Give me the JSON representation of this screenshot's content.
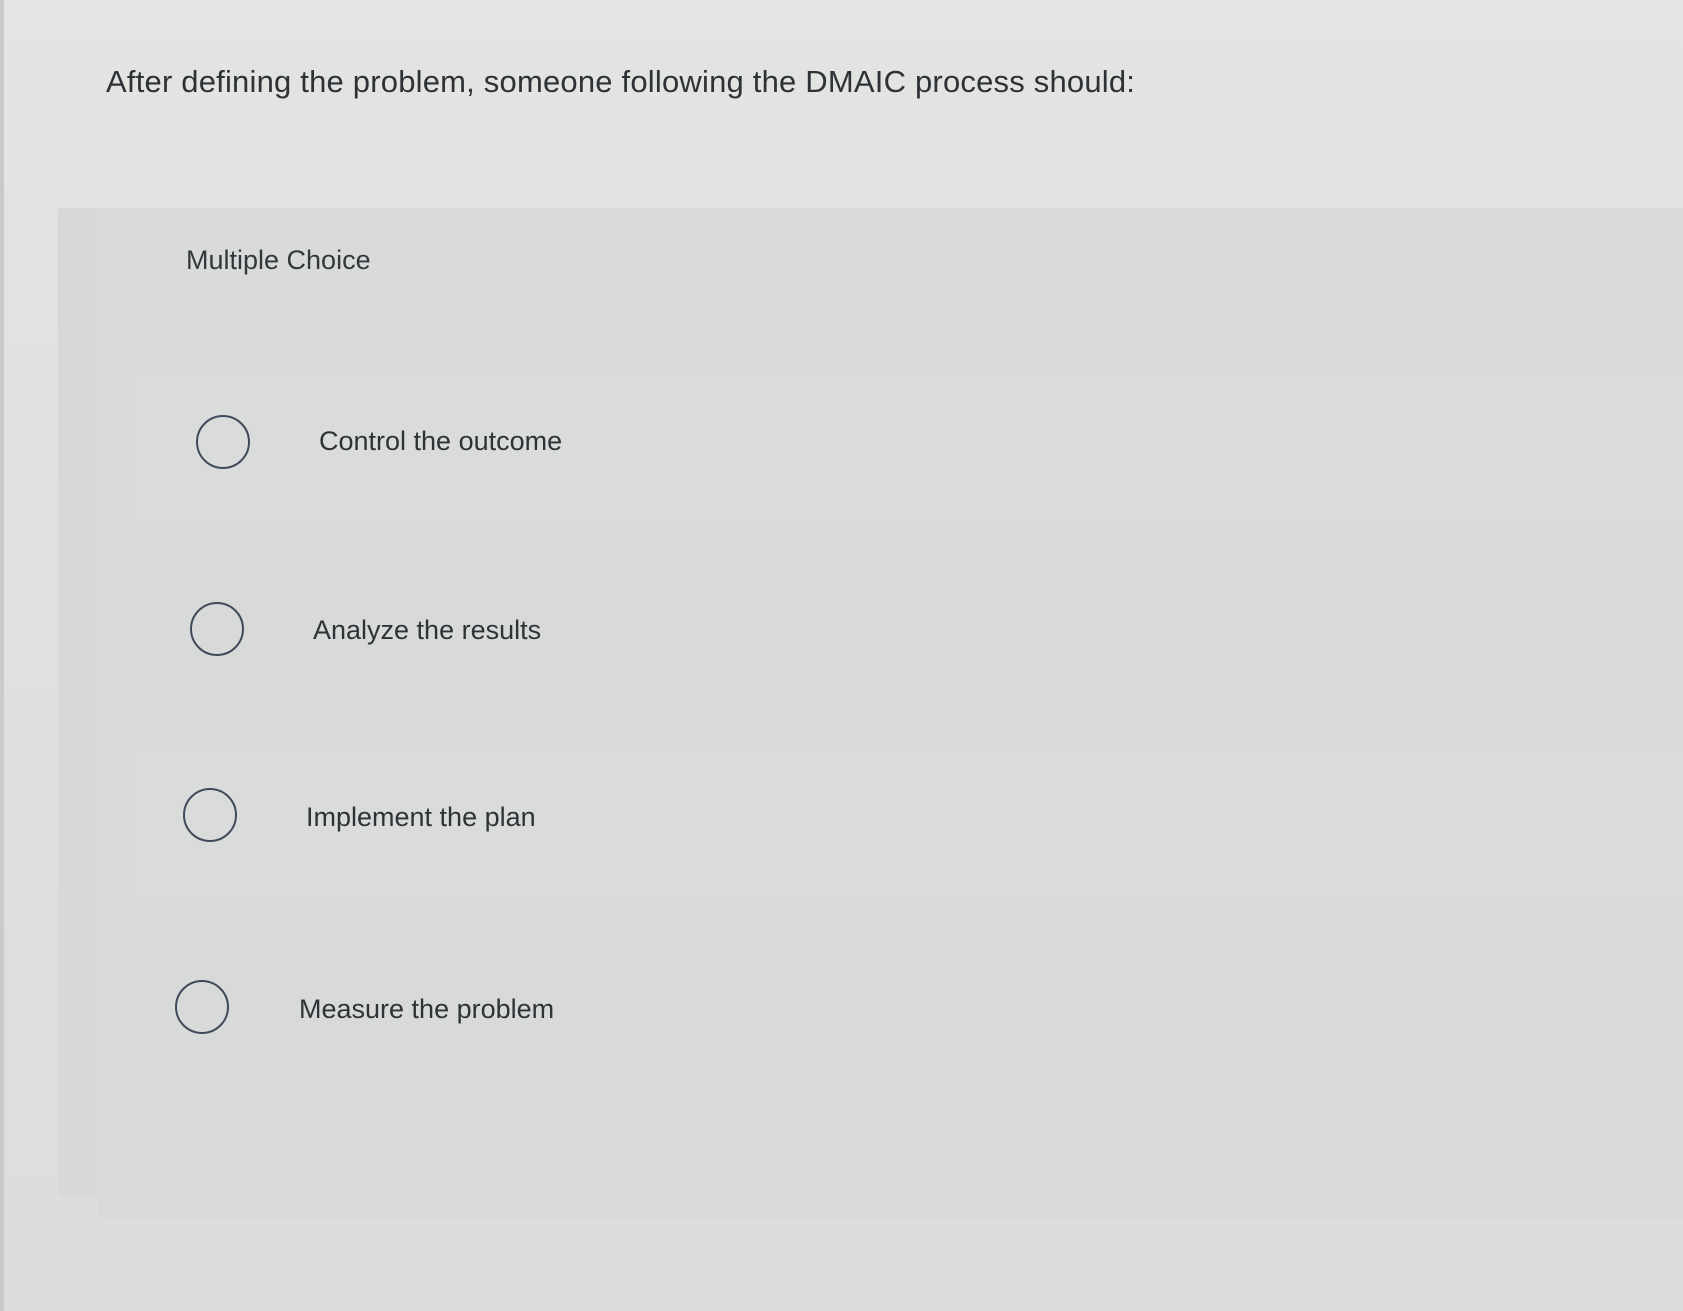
{
  "question": {
    "text": "After defining the problem, someone following the DMAIC process should:"
  },
  "answer_area": {
    "type_label": "Multiple Choice",
    "options": [
      {
        "label": "Control the outcome",
        "selected": false
      },
      {
        "label": "Analyze the results",
        "selected": false
      },
      {
        "label": "Implement the plan",
        "selected": false
      },
      {
        "label": "Measure the problem",
        "selected": false
      }
    ]
  }
}
